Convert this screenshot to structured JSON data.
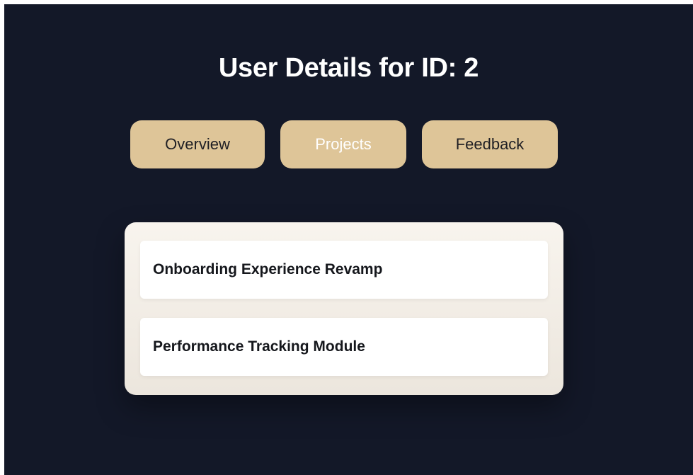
{
  "page": {
    "title": "User Details for ID: 2"
  },
  "tabs": [
    {
      "label": "Overview",
      "active": false
    },
    {
      "label": "Projects",
      "active": true
    },
    {
      "label": "Feedback",
      "active": false
    }
  ],
  "projects": [
    {
      "name": "Onboarding Experience Revamp"
    },
    {
      "name": "Performance Tracking Module"
    }
  ],
  "colors": {
    "background": "#131828",
    "tab_background": "#dec598",
    "panel_background": "#f4efe8",
    "item_background": "#ffffff"
  }
}
